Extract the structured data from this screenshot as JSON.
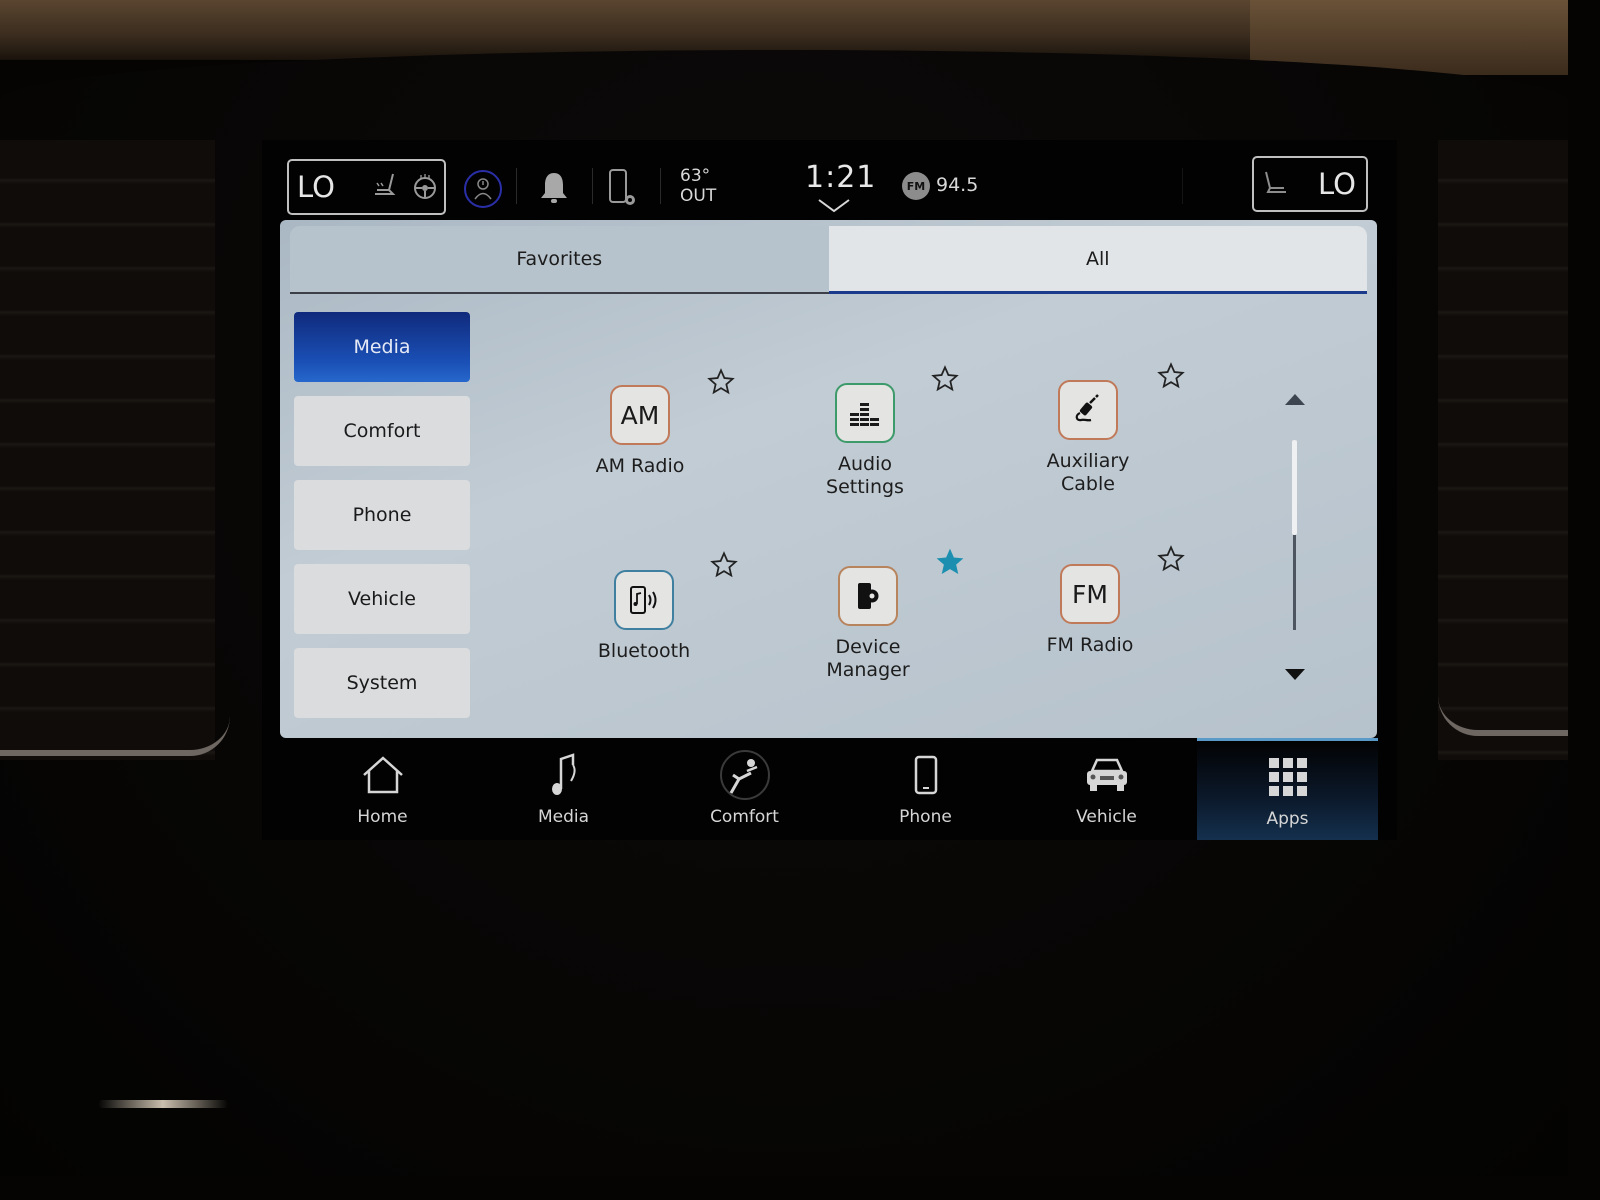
{
  "status_bar": {
    "driver_temp": "LO",
    "passenger_temp": "LO",
    "outside_temp_value": "63°",
    "outside_temp_label": "OUT",
    "clock": "1:21",
    "radio_band": "FM",
    "radio_frequency": "94.5"
  },
  "tabs": [
    {
      "label": "Favorites",
      "selected": false
    },
    {
      "label": "All",
      "selected": true
    }
  ],
  "categories": [
    {
      "label": "Media",
      "selected": true
    },
    {
      "label": "Comfort",
      "selected": false
    },
    {
      "label": "Phone",
      "selected": false
    },
    {
      "label": "Vehicle",
      "selected": false
    },
    {
      "label": "System",
      "selected": false
    }
  ],
  "apps": [
    {
      "label_line1": "AM Radio",
      "label_line2": "",
      "icon": "am-text-icon",
      "icon_text": "AM",
      "favorite": false
    },
    {
      "label_line1": "Audio",
      "label_line2": "Settings",
      "icon": "equalizer-icon",
      "icon_text": "",
      "favorite": false
    },
    {
      "label_line1": "Auxiliary",
      "label_line2": "Cable",
      "icon": "aux-cable-icon",
      "icon_text": "",
      "favorite": false
    },
    {
      "label_line1": "Bluetooth",
      "label_line2": "",
      "icon": "bluetooth-audio-icon",
      "icon_text": "",
      "favorite": false
    },
    {
      "label_line1": "Device",
      "label_line2": "Manager",
      "icon": "device-manager-icon",
      "icon_text": "",
      "favorite": true
    },
    {
      "label_line1": "FM Radio",
      "label_line2": "",
      "icon": "fm-text-icon",
      "icon_text": "FM",
      "favorite": false
    }
  ],
  "scroll": {
    "position_fraction": 0.0,
    "visible_fraction": 0.5
  },
  "nav": [
    {
      "label": "Home",
      "icon": "home-icon",
      "active": false
    },
    {
      "label": "Media",
      "icon": "music-note-icon",
      "active": false
    },
    {
      "label": "Comfort",
      "icon": "seat-comfort-icon",
      "active": false
    },
    {
      "label": "Phone",
      "icon": "phone-icon",
      "active": false
    },
    {
      "label": "Vehicle",
      "icon": "car-icon",
      "active": false
    },
    {
      "label": "Apps",
      "icon": "apps-grid-icon",
      "active": true
    }
  ],
  "colors": {
    "accent_blue": "#1a4fb5",
    "favorite_star": "#1c8fb0",
    "active_nav_underline": "#5a9ac8"
  }
}
